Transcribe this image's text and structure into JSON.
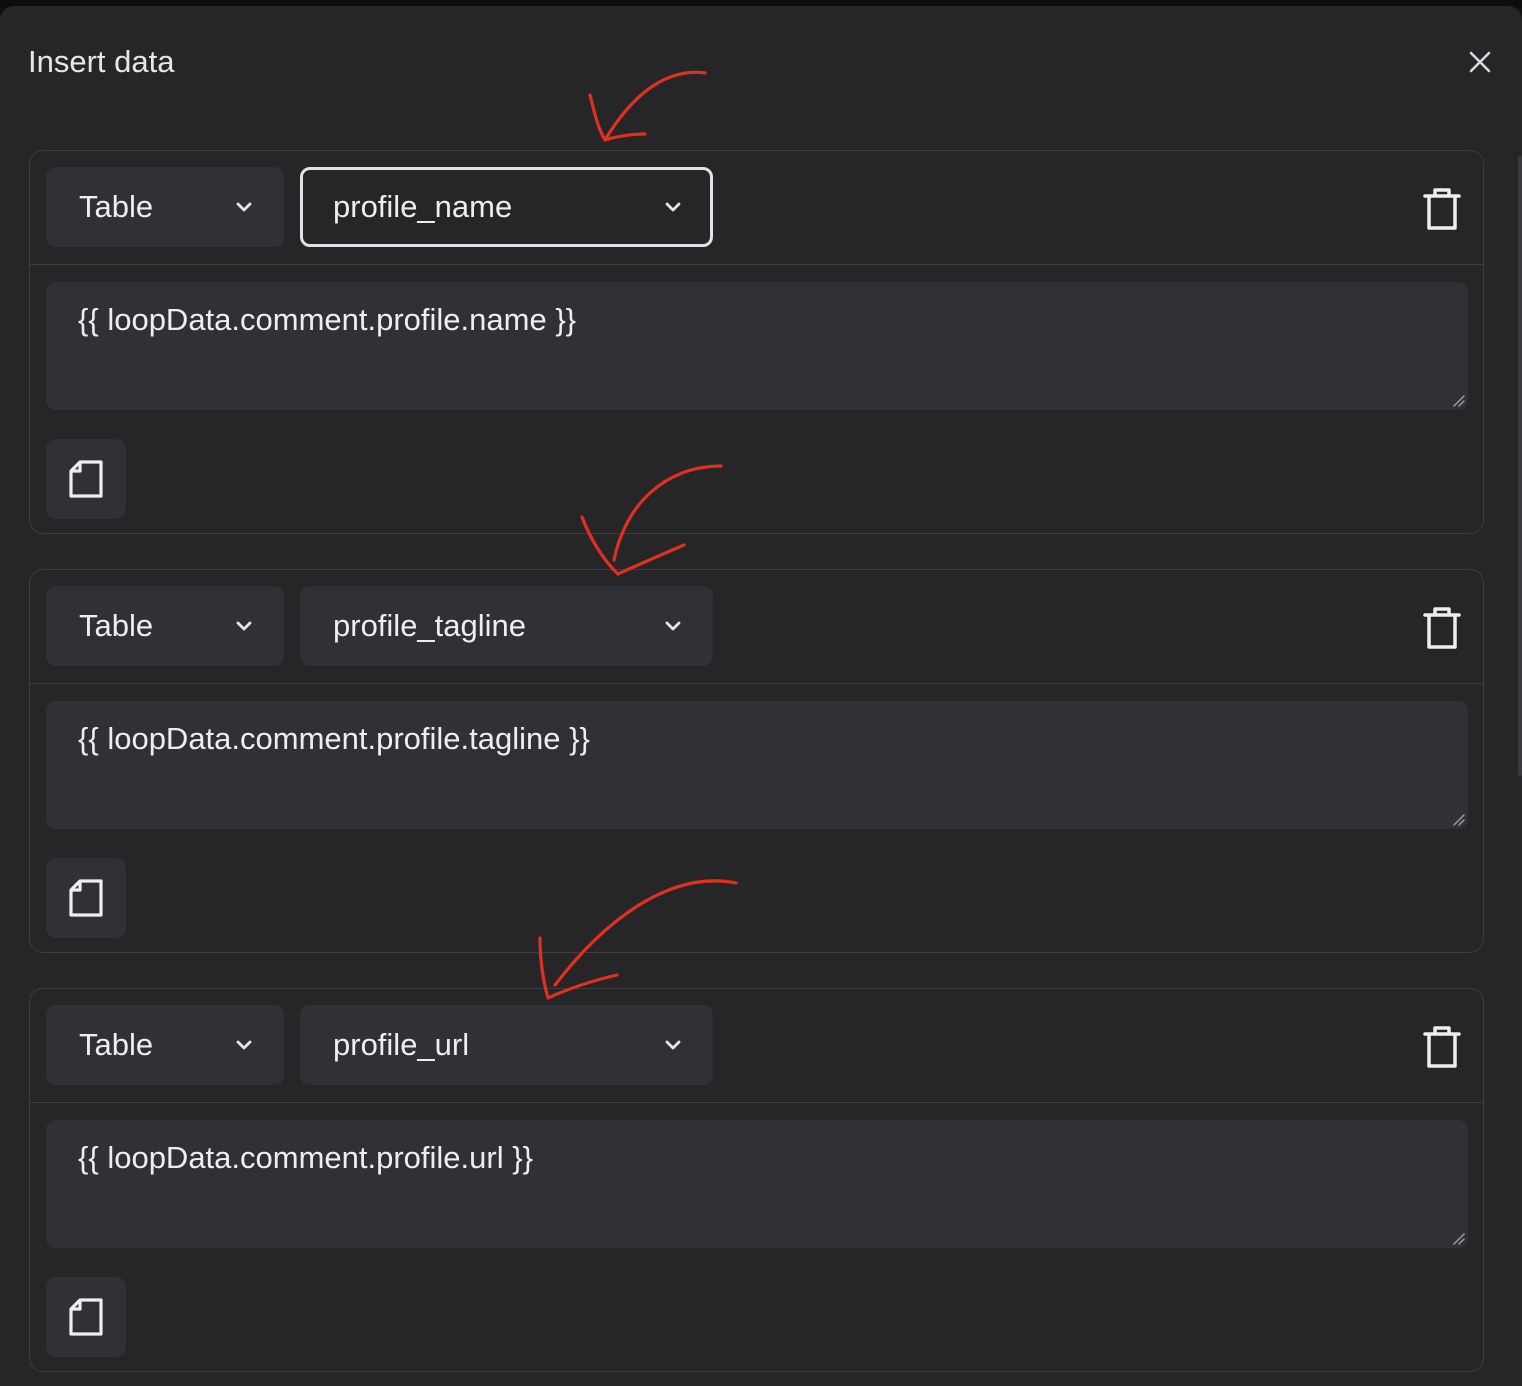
{
  "dialog": {
    "title": "Insert data",
    "close_icon": "close-icon"
  },
  "rows": [
    {
      "type_label": "Table",
      "column_label": "profile_name",
      "value": "{{ loopData.comment.profile.name }}",
      "column_focused": true
    },
    {
      "type_label": "Table",
      "column_label": "profile_tagline",
      "value": "{{ loopData.comment.profile.tagline }}",
      "column_focused": false
    },
    {
      "type_label": "Table",
      "column_label": "profile_url",
      "value": "{{ loopData.comment.profile.url }}",
      "column_focused": false
    }
  ],
  "icons": {
    "dropdown": "chevron-down-icon",
    "delete": "trash-icon",
    "copy": "document-icon",
    "resize": "resize-grip-icon"
  },
  "colors": {
    "background": "#262629",
    "field": "#313135",
    "border": "#3c3c41",
    "text": "#eeeef0",
    "annotation": "#e0301e"
  }
}
